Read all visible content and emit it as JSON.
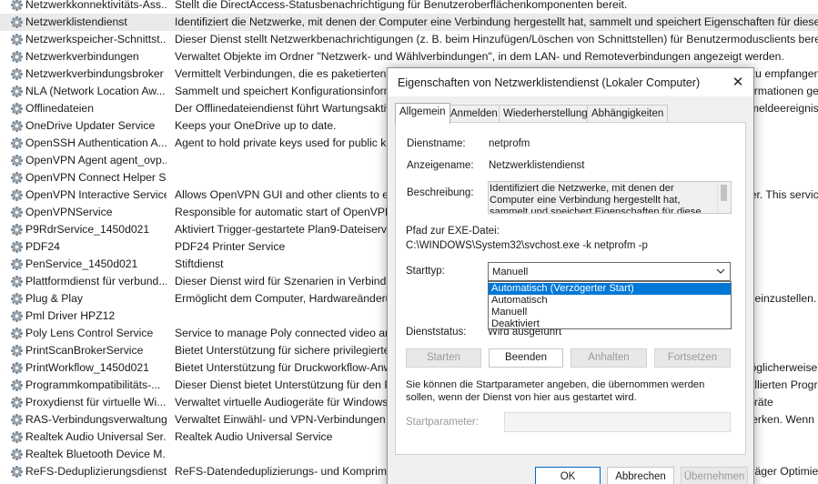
{
  "services": [
    {
      "name": "Netzwerkkonnektivitäts-Ass...",
      "description": "Stellt die DirectAccess-Statusbenachrichtigung für Benutzeroberflächenkomponenten bereit.",
      "selected": false
    },
    {
      "name": "Netzwerklistendienst",
      "description": "Identifiziert die Netzwerke, mit denen der Computer eine Verbindung hergestellt hat, sammelt und speichert Eigenschaften für diese Netzwerke",
      "selected": true
    },
    {
      "name": "Netzwerkspeicher-Schnittst...",
      "description": "Dieser Dienst stellt Netzwerkbenachrichtigungen (z. B. beim Hinzufügen/Löschen von Schnittstellen) für Benutzermodusclients bereit. Wenn",
      "selected": false
    },
    {
      "name": "Netzwerkverbindungen",
      "description": "Verwaltet Objekte im Ordner \"Netzwerk- und Wählverbindungen\", in dem LAN- und Remoteverbindungen angezeigt werden.",
      "selected": false
    },
    {
      "name": "Netzwerkverbindungsbroker",
      "description": "Vermittelt Verbindungen, die es paketierten Microsoft Store-Apps ermöglichen, Benachrichtigungen aus dem Internet zu empfangen.",
      "selected": false
    },
    {
      "name": "NLA (Network Location Aw...",
      "description": "Sammelt und speichert Konfigurationsinformationen für das Netzwerk und benachrichtigt Programme, wenn diese Informationen geändert werden.",
      "selected": false
    },
    {
      "name": "Offlinedateien",
      "description": "Der Offlinedateiendienst führt Wartungsaktivitäten im Offlinedateicache durch, reagiert auf Benutzeranmelde- und -abmeldeereignisse.",
      "selected": false
    },
    {
      "name": "OneDrive Updater Service",
      "description": "Keeps your OneDrive up to date.",
      "selected": false
    },
    {
      "name": "OpenSSH Authentication A...",
      "description": "Agent to hold private keys used for public key authentication.",
      "selected": false
    },
    {
      "name": "OpenVPN Agent agent_ovp...",
      "description": "",
      "selected": false
    },
    {
      "name": "OpenVPN Connect Helper S...",
      "description": "",
      "selected": false
    },
    {
      "name": "OpenVPN Interactive Service",
      "description": "Allows OpenVPN GUI and other clients to establish OpenVPN connections without administrative privileges for the user. This service is needed as ay.",
      "selected": false
    },
    {
      "name": "OpenVPNService",
      "description": "Responsible for automatic start of OpenVPN connections.",
      "selected": false
    },
    {
      "name": "P9RdrService_1450d021",
      "description": "Aktiviert Trigger-gestartete Plan9-Dateiserver.",
      "selected": false
    },
    {
      "name": "PDF24",
      "description": "PDF24 Printer Service",
      "selected": false
    },
    {
      "name": "PenService_1450d021",
      "description": "Stiftdienst",
      "selected": false
    },
    {
      "name": "Plattformdienst für verbund...",
      "description": "Dieser Dienst wird für Szenarien in Verbindung mit Geräten verwendet.",
      "selected": false
    },
    {
      "name": "Plug & Play",
      "description": "Ermöglicht dem Computer, Hardwareänderungen zu erkennen und sich mit wenigen oder ohne Benutzereingaben auf einzustellen.",
      "selected": false
    },
    {
      "name": "Pml Driver HPZ12",
      "description": "",
      "selected": false
    },
    {
      "name": "Poly Lens Control Service",
      "description": "Service to manage Poly connected video and audio devices.",
      "selected": false
    },
    {
      "name": "PrintScanBrokerService",
      "description": "Bietet Unterstützung für sichere privilegierte Vorgänge.",
      "selected": false
    },
    {
      "name": "PrintWorkflow_1450d021",
      "description": "Bietet Unterstützung für Druckworkflow-Anwendungen. Wenn Sie diesen Dienst deaktivieren, ist die Druckausgabe möglicherweise nicht erfolgreich.",
      "selected": false
    },
    {
      "name": "Programmkompatibilitäts-...",
      "description": "Dieser Dienst bietet Unterstützung für den Programmkompatibilitäts-Assistenten. Er überwacht die vom Benutzer installierten Programme. Mit dem PCA",
      "selected": false
    },
    {
      "name": "Proxydienst für virtuelle Wi...",
      "description": "Verwaltet virtuelle Audiogeräte für Windows-Sandbox- und VM-Gäste und stellt sie für die Verwendung bereit. Audiogeräte",
      "selected": false
    },
    {
      "name": "RAS-Verbindungsverwaltung",
      "description": "Verwaltet Einwähl- und VPN-Verbindungen zwischen diesem Computer und dem Internet oder anderen Remotenetzwerken. Wenn dieser",
      "selected": false
    },
    {
      "name": "Realtek Audio Universal Ser...",
      "description": "Realtek Audio Universal Service",
      "selected": false
    },
    {
      "name": "Realtek Bluetooth Device M...",
      "description": "",
      "selected": false
    },
    {
      "name": "ReFS-Deduplizierungsdienst",
      "description": "ReFS-Datendeduplizierungs- und Komprimierungsdienst, der Speicherplatz spart und die Leistung verbessert. Datenträger Optimierung",
      "selected": false
    }
  ],
  "dialog": {
    "title": "Eigenschaften von Netzwerklistendienst (Lokaler Computer)",
    "close_glyph": "✕",
    "tabs": [
      "Allgemein",
      "Anmelden",
      "Wiederherstellung",
      "Abhängigkeiten"
    ],
    "active_tab": "Allgemein",
    "service_name_label": "Dienstname:",
    "service_name": "netprofm",
    "display_name_label": "Anzeigename:",
    "display_name": "Netzwerklistendienst",
    "description_label": "Beschreibung:",
    "description": "Identifiziert die Netzwerke, mit denen der Computer eine Verbindung hergestellt hat, sammelt und speichert Eigenschaften für diese Netzwerke, und",
    "exe_path_label": "Pfad zur EXE-Datei:",
    "exe_path": "C:\\WINDOWS\\System32\\svchost.exe -k netprofm -p",
    "starttype_label": "Starttyp:",
    "starttype_value": "Manuell",
    "starttype_options": [
      "Automatisch (Verzögerter Start)",
      "Automatisch",
      "Manuell",
      "Deaktiviert"
    ],
    "starttype_highlighted": "Automatisch (Verzögerter Start)",
    "status_label": "Dienststatus:",
    "status_value": "Wird ausgeführt",
    "buttons": {
      "start": "Starten",
      "stop": "Beenden",
      "pause": "Anhalten",
      "resume": "Fortsetzen"
    },
    "hint": "Sie können die Startparameter angeben, die übernommen werden sollen, wenn der Dienst von hier aus gestartet wird.",
    "start_params_label": "Startparameter:",
    "start_params_value": "",
    "footer": {
      "ok": "OK",
      "cancel": "Abbrechen",
      "apply": "Übernehmen"
    }
  },
  "colors": {
    "selection_highlight": "#0078d7",
    "selected_row": "#eaeaea",
    "dialog_background": "#f0f0f0"
  },
  "icons": {
    "service": "gear-icon",
    "close": "close-icon",
    "dropdown": "chevron-down-icon"
  }
}
